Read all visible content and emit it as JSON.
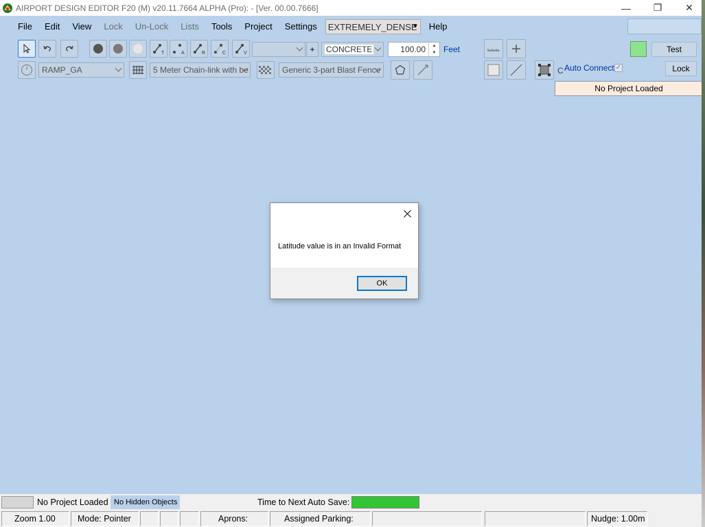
{
  "window": {
    "title": "AIRPORT DESIGN EDITOR F20 (M)  v20.11.7664 ALPHA (Pro):  -  [Ver. 00.00.7666]",
    "minimize_glyph": "—",
    "maximize_glyph": "❐",
    "close_glyph": "✕"
  },
  "menu": {
    "items": [
      {
        "label": "File",
        "disabled": false
      },
      {
        "label": "Edit",
        "disabled": false
      },
      {
        "label": "View",
        "disabled": false
      },
      {
        "label": "Lock",
        "disabled": true
      },
      {
        "label": "Un-Lock",
        "disabled": true
      },
      {
        "label": "Lists",
        "disabled": true
      },
      {
        "label": "Tools",
        "disabled": false
      },
      {
        "label": "Project",
        "disabled": false
      },
      {
        "label": "Settings",
        "disabled": false
      }
    ],
    "density_value": "EXTREMELY_DENSE",
    "help": "Help"
  },
  "toolbar1": {
    "surface_type": "CONCRETE",
    "width_value": "100.00",
    "unit": "Feet",
    "plus": "+",
    "test_button": "Test",
    "swatch_color": "#8fe28f",
    "node_letters": [
      "T",
      "A",
      "R",
      "C",
      "V"
    ]
  },
  "toolbar2": {
    "ramp_type": "RAMP_GA",
    "fence_type": "5 Meter Chain-link with be",
    "blast_fence": "Generic 3-part Blast Fence",
    "auto_connect": "Auto Connect",
    "auto_connect_checked": "✓",
    "lock_button": "Lock",
    "partial_label": "C"
  },
  "project_status": "No Project Loaded",
  "dialog": {
    "message": "Latitude value is in an Invalid Format",
    "ok": "OK"
  },
  "statusbar1": {
    "project": "No Project Loaded",
    "hidden_objects": "No Hidden Objects",
    "autosave_label": "Time to Next Auto Save:",
    "autosave_progress": 1.0,
    "autosave_color": "#34c534"
  },
  "statusbar2": {
    "zoom": "Zoom 1.00",
    "mode": "Mode: Pointer",
    "aprons": "Aprons:",
    "parking": "Assigned Parking:",
    "nudge": "Nudge: 1.00m"
  }
}
